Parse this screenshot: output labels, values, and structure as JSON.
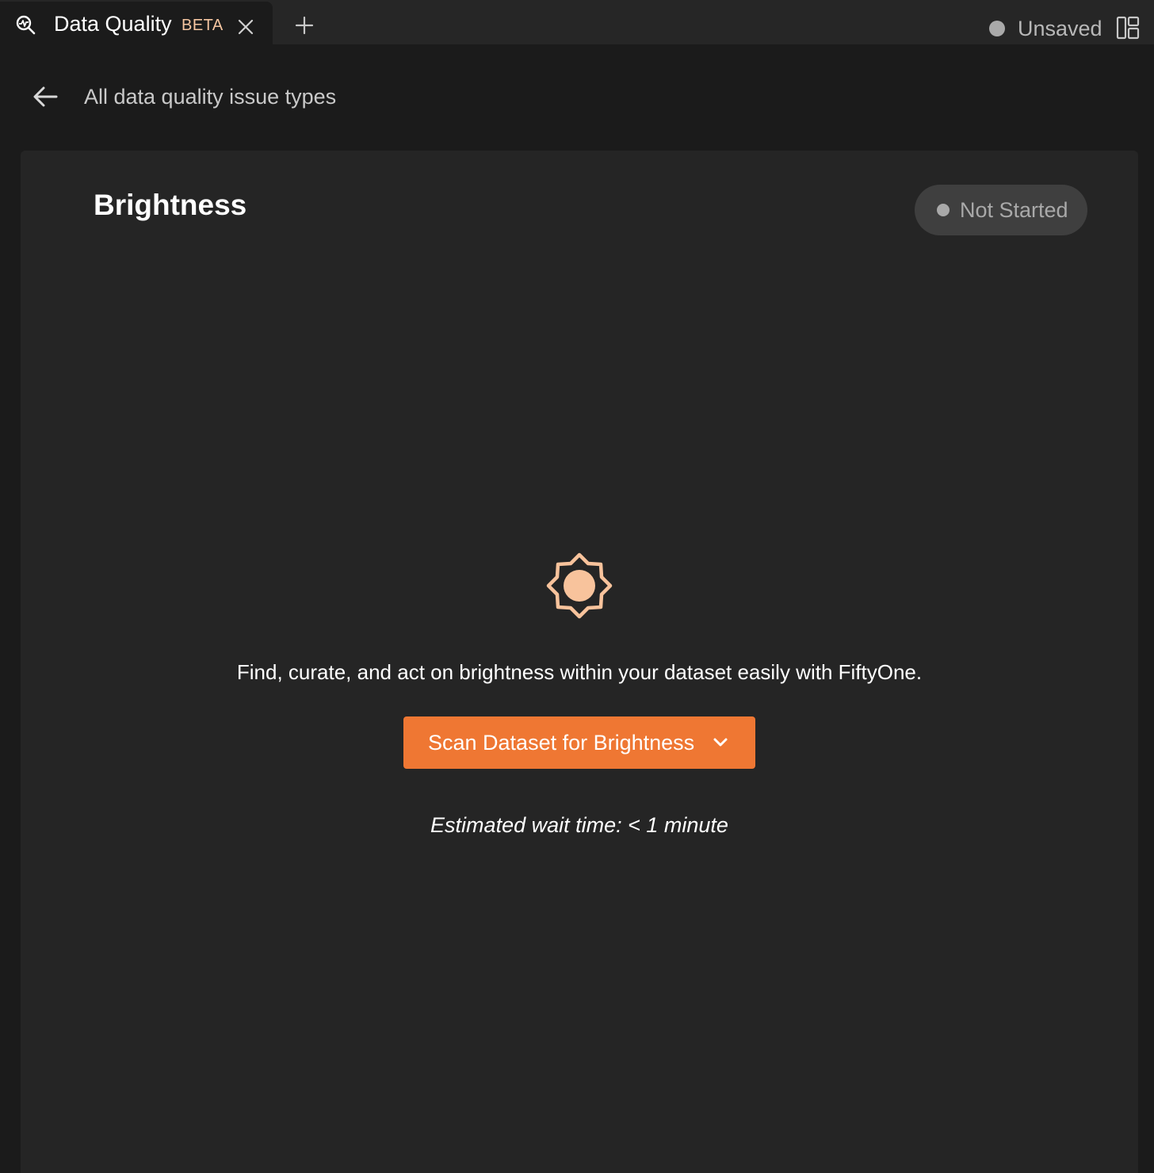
{
  "tab": {
    "title": "Data Quality",
    "badge": "BETA",
    "icon": "data-quality-search-icon",
    "close_icon": "close-icon"
  },
  "new_tab_icon": "plus-icon",
  "header_status": {
    "label": "Unsaved",
    "dot_color": "#a9a9a9"
  },
  "layout_icon": "layout-grid-icon",
  "back": {
    "icon": "arrow-left-icon",
    "label": "All data quality issue types"
  },
  "card": {
    "title": "Brightness",
    "status": {
      "label": "Not Started",
      "dot_color": "#a9a9a9"
    },
    "illustration_icon": "sun-icon",
    "description": "Find, curate, and act on brightness within your dataset easily with FiftyOne.",
    "scan_button": {
      "label": "Scan Dataset for Brightness",
      "icon": "chevron-down-icon"
    },
    "wait_time": "Estimated wait time: < 1 minute"
  },
  "colors": {
    "background": "#1b1b1b",
    "tabbar": "#262626",
    "card": "#252525",
    "accent": "#ef7733",
    "badge": "#f6c6a1",
    "sun_fill": "#f8c39c",
    "pill": "#3f3f3f"
  }
}
